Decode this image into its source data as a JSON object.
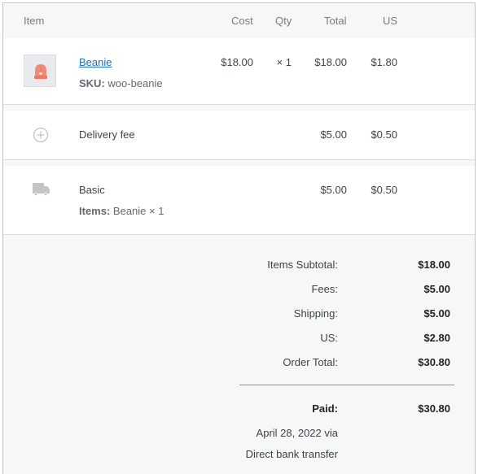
{
  "table": {
    "headers": {
      "item": "Item",
      "cost": "Cost",
      "qty": "Qty",
      "total": "Total",
      "tax": "US"
    },
    "line_item": {
      "name": "Beanie",
      "sku_label": "SKU:",
      "sku": "woo-beanie",
      "cost": "$18.00",
      "qty": "× 1",
      "total": "$18.00",
      "tax": "$1.80",
      "thumbnail_icon": "beanie-product-image"
    },
    "fee": {
      "icon": "plus-circle-icon",
      "name": "Delivery fee",
      "total": "$5.00",
      "tax": "$0.50"
    },
    "shipping": {
      "icon": "truck-icon",
      "name": "Basic",
      "items_label": "Items:",
      "items": "Beanie × 1",
      "total": "$5.00",
      "tax": "$0.50"
    }
  },
  "totals": {
    "rows": [
      {
        "label": "Items Subtotal:",
        "value": "$18.00"
      },
      {
        "label": "Fees:",
        "value": "$5.00"
      },
      {
        "label": "Shipping:",
        "value": "$5.00"
      },
      {
        "label": "US:",
        "value": "$2.80"
      },
      {
        "label": "Order Total:",
        "value": "$30.80"
      }
    ],
    "paid": {
      "label": "Paid:",
      "value": "$30.80",
      "date_line": "April 28, 2022 via",
      "method_line": "Direct bank transfer"
    }
  },
  "colors": {
    "link": "#2271b1",
    "text": "#3c434a",
    "muted": "#787c82",
    "beanie": "#f08b7a"
  }
}
